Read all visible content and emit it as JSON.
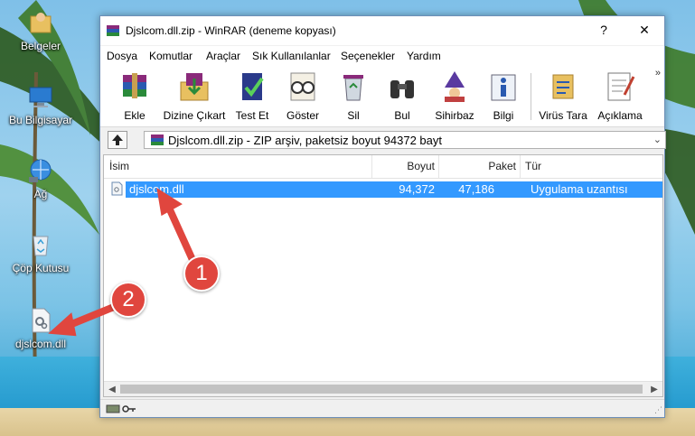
{
  "desktop": {
    "icons": [
      {
        "label": "Belgeler"
      },
      {
        "label": "Bu Bilgisayar"
      },
      {
        "label": "Ağ"
      },
      {
        "label": "Çöp Kutusu"
      },
      {
        "label": "djslcom.dll"
      }
    ]
  },
  "window": {
    "title": "Djslcom.dll.zip - WinRAR (deneme kopyası)",
    "help_btn": "?",
    "close_btn": "✕"
  },
  "menu": {
    "items": [
      "Dosya",
      "Komutlar",
      "Araçlar",
      "Sık Kullanılanlar",
      "Seçenekler",
      "Yardım"
    ]
  },
  "toolbar": {
    "items": [
      "Ekle",
      "Dizine Çıkart",
      "Test Et",
      "Göster",
      "Sil",
      "Bul",
      "Sihirbaz",
      "Bilgi",
      "Virüs Tara",
      "Açıklama"
    ],
    "overflow": "»"
  },
  "address": {
    "text": "Djslcom.dll.zip - ZIP arşiv, paketsiz boyut 94372 bayt",
    "caret": "⌄"
  },
  "list": {
    "columns": [
      "İsim",
      "Boyut",
      "Paket",
      "Tür"
    ],
    "rows": [
      {
        "name": "djslcom.dll",
        "size": "94,372",
        "packed": "47,186",
        "type": "Uygulama uzantısı"
      }
    ]
  },
  "callouts": [
    "1",
    "2"
  ],
  "colors": {
    "selection": "#3399ff",
    "callout": "#e0463e"
  }
}
